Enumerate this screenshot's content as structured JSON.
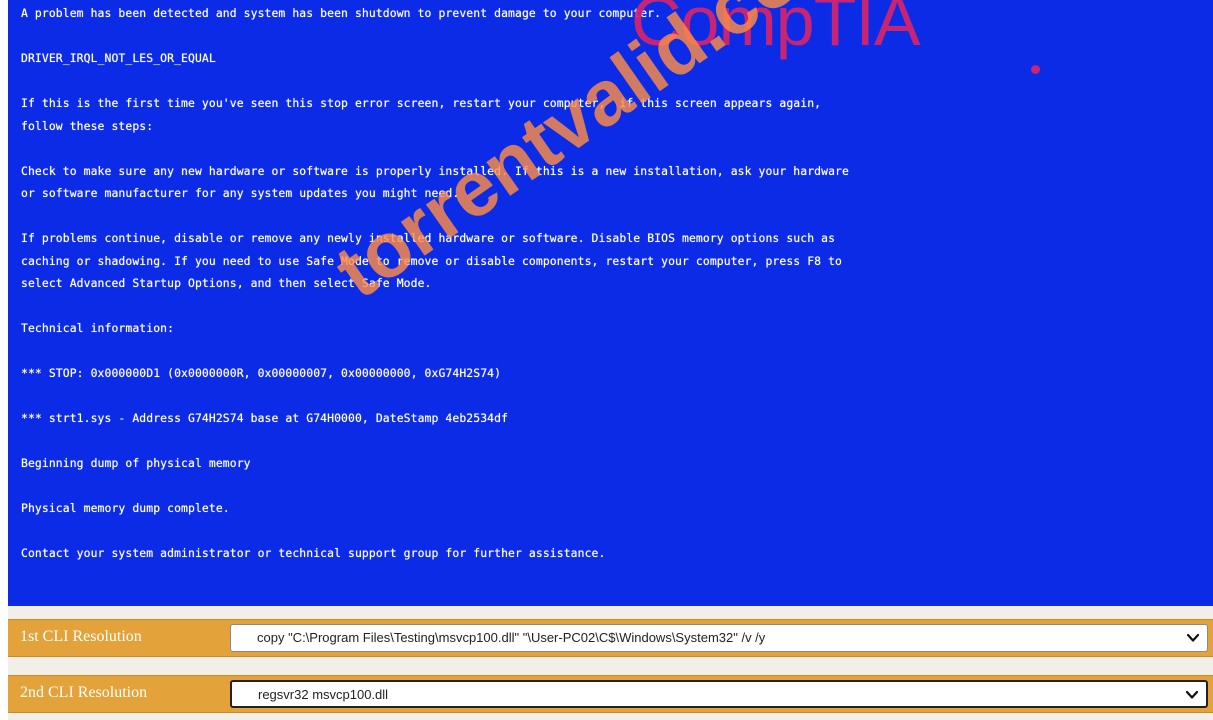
{
  "bsod": {
    "lines": [
      "A problem has been detected and system has been shutdown to prevent damage to your computer.",
      "",
      "DRIVER_IRQL_NOT_LES_OR_EQUAL",
      "",
      "If this is the first time you've seen this stop error screen, restart your computer,  if this screen appears again,",
      "follow these steps:",
      "",
      "Check to make sure any new hardware or software is properly installed. If this is a new installation, ask your hardware",
      "or software manufacturer for any system updates you might need.",
      "",
      "If problems continue, disable or remove any newly installed hardware or software. Disable BIOS memory options such as",
      "caching or shadowing. If you need to use Safe Mode to remove or disable components, restart your computer, press F8 to",
      "select Advanced Startup Options, and then select Safe Mode.",
      "",
      "Technical information:",
      "",
      "*** STOP: 0x000000D1 (0x0000000R, 0x00000007, 0x00000000, 0xG74H2S74)",
      "",
      "*** strt1.sys - Address G74H2S74 base at G74H0000, DateStamp 4eb2534df",
      "",
      "Beginning dump of physical memory",
      "",
      "Physical memory dump complete.",
      "",
      "Contact your system administrator or technical support group for further assistance."
    ],
    "background_color": "#0c2be6"
  },
  "logo": {
    "text": "CompTIA",
    "color": "#d8246b"
  },
  "watermark": {
    "text": "torrentvalid.com"
  },
  "resolutions": [
    {
      "label": "1st CLI Resolution",
      "selected": "copy \"C:\\Program Files\\Testing\\msvcp100.dll\" \"\\User-PC02\\C$\\Windows\\System32\" /v /y"
    },
    {
      "label": "2nd CLI Resolution",
      "selected": "regsvr32 msvcp100.dll"
    }
  ],
  "colors": {
    "row_background": "#e3a23a",
    "label_text": "#ffffff"
  },
  "icons": {
    "dropdown": "chevron-down-icon"
  }
}
